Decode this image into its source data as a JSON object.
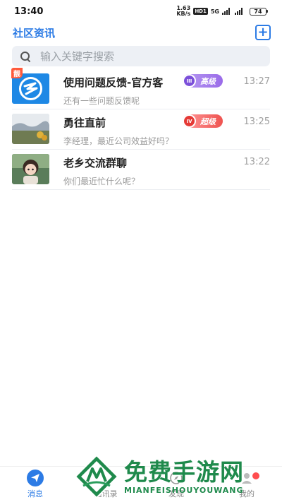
{
  "status_bar": {
    "time": "13:40",
    "net_speed_value": "1.63",
    "net_speed_unit": "KB/s",
    "hd_label": "HD1",
    "network": "5G",
    "battery": "74"
  },
  "header": {
    "title": "社区资讯",
    "add_icon": "plus-square-icon"
  },
  "search": {
    "placeholder": "输入关键字搜索"
  },
  "chats": [
    {
      "name": "使用问题反馈-官方客",
      "preview": "还有一些问题反馈呢",
      "time": "13:27",
      "tag": "靓",
      "badge_level": "III",
      "badge_label": "高级"
    },
    {
      "name": "勇往直前",
      "preview": "李经理，最近公司效益好吗？",
      "time": "13:25",
      "badge_level": "IV",
      "badge_label": "超级"
    },
    {
      "name": "老乡交流群聊",
      "preview": "你们最近忙什么呢？",
      "time": "13:22"
    }
  ],
  "tabbar": {
    "tabs": [
      {
        "label": "消息",
        "icon": "send-icon"
      },
      {
        "label": "通讯录",
        "icon": "contacts-icon"
      },
      {
        "label": "发现",
        "icon": "discover-icon"
      },
      {
        "label": "我的",
        "icon": "profile-icon"
      }
    ]
  },
  "watermark": {
    "title": "免费手游网",
    "subtitle": "MIANFEISHOUYOUWANG"
  },
  "colors": {
    "accent": "#2c7be5",
    "watermark_green": "#1f8a4c"
  }
}
